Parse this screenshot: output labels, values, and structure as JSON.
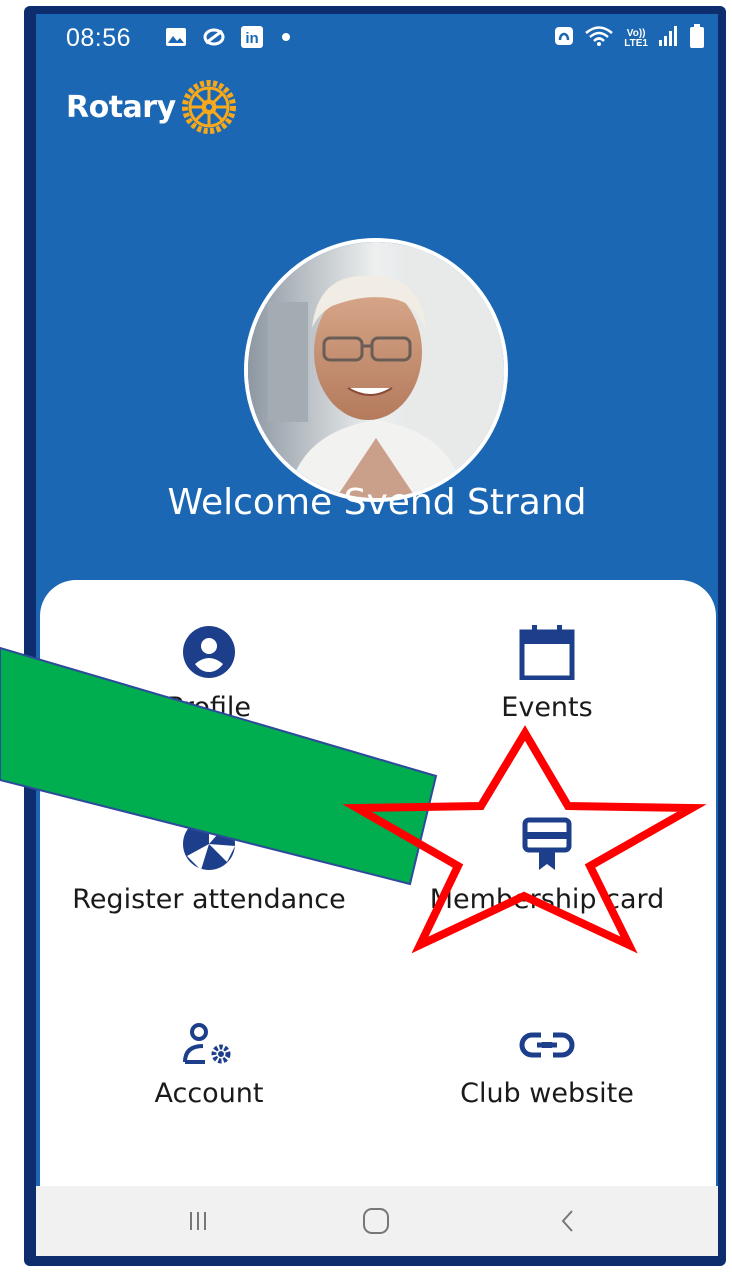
{
  "status_bar": {
    "time": "08:56",
    "notification_icons": [
      "image-icon",
      "sync-icon",
      "linkedin-icon"
    ],
    "linkedin_glyph": "in",
    "right_icons": [
      "nfc-icon",
      "wifi-icon",
      "volte-icon",
      "signal-icon",
      "battery-icon"
    ],
    "volte_top": "Vo))",
    "volte_bottom": "LTE1"
  },
  "header": {
    "logo_text": "Rotary"
  },
  "welcome": {
    "text": "Welcome Svend Strand"
  },
  "menu": {
    "profile": "Profile",
    "events": "Events",
    "register_attendance": "Register attendance",
    "membership_card": "Membership card",
    "account": "Account",
    "club_website": "Club website"
  },
  "colors": {
    "app_blue": "#1b67b3",
    "icon_navy": "#1d3f8b",
    "frame_navy": "#0d2d6e",
    "rotary_gold": "#f7a81b",
    "arrow_green": "#00ad4f",
    "star_red": "#ff0000"
  },
  "annotations": [
    "green-arrow-overlay",
    "red-star-outline"
  ],
  "nav_bar": {
    "buttons": [
      "recent-apps-icon",
      "home-icon",
      "back-icon"
    ]
  }
}
